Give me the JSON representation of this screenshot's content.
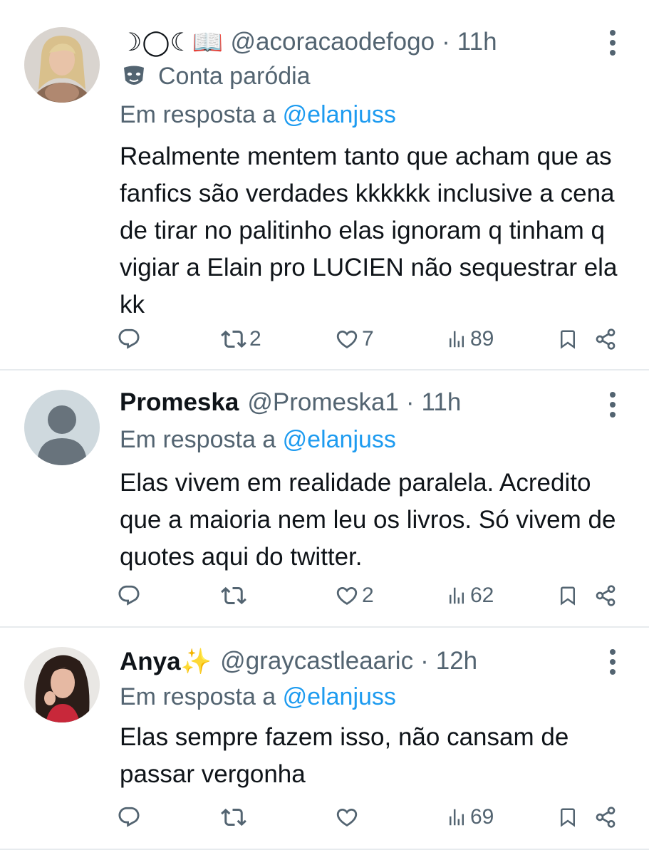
{
  "tweets": [
    {
      "display_name": "☽◯☾📖",
      "handle": "@acoracaodefogo",
      "separator": "·",
      "time": "11h",
      "label": "Conta paródia",
      "reply_prefix": "Em resposta a",
      "reply_mention": "@elanjuss",
      "text": "Realmente mentem tanto que acham que as fanfics são verdades kkkkkk inclusive a cena de tirar no palitinho elas ignoram q tinham q vigiar a Elain pro LUCIEN não sequestrar ela kk",
      "replies": "",
      "reposts": "2",
      "likes": "7",
      "views": "89"
    },
    {
      "display_name": "Promeska",
      "handle": "@Promeska1",
      "separator": "·",
      "time": "11h",
      "reply_prefix": "Em resposta a",
      "reply_mention": "@elanjuss",
      "text": "Elas vivem em realidade paralela. Acredito que a maioria nem leu os livros. Só vivem de quotes aqui do twitter.",
      "replies": "",
      "reposts": "",
      "likes": "2",
      "views": "62"
    },
    {
      "display_name": "Anya✨",
      "handle": "@graycastleaaric",
      "separator": "·",
      "time": "12h",
      "reply_prefix": "Em resposta a",
      "reply_mention": "@elanjuss",
      "text": "Elas sempre fazem isso, não cansam de passar vergonha",
      "replies": "",
      "reposts": "",
      "likes": "",
      "views": "69"
    }
  ],
  "colors": {
    "text": "#0f1419",
    "secondary": "#536471",
    "mention": "#1d9bf0",
    "divider": "#e7ebee",
    "placeholder_avatar": "#cfd9de"
  },
  "icons": [
    "more-icon",
    "mask-icon",
    "reply-icon",
    "repost-icon",
    "like-icon",
    "views-icon",
    "bookmark-icon",
    "share-icon"
  ]
}
